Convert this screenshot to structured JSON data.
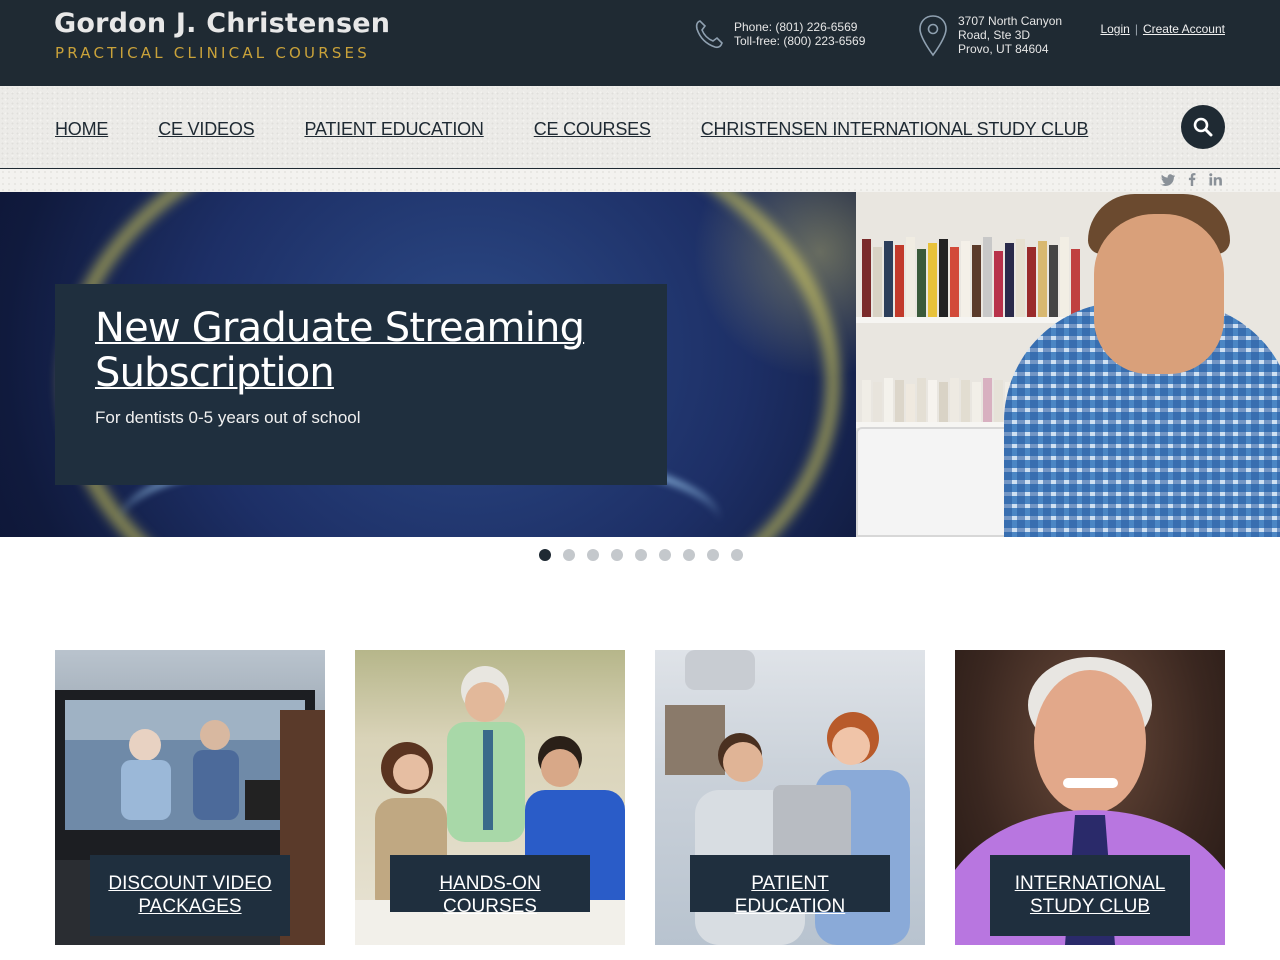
{
  "header": {
    "logo_title": "Gordon J. Christensen",
    "logo_subtitle": "PRACTICAL CLINICAL COURSES",
    "phone_line": "Phone: (801) 226-6569",
    "tollfree_line": "Toll-free: (800) 223-6569",
    "address_line1": "3707 North Canyon",
    "address_line2": "Road, Ste 3D",
    "address_line3": "Provo, UT 84604",
    "login_label": "Login",
    "separator": "|",
    "create_account_label": "Create Account"
  },
  "nav": {
    "items": [
      {
        "label": "HOME"
      },
      {
        "label": "CE VIDEOS"
      },
      {
        "label": "PATIENT EDUCATION"
      },
      {
        "label": "CE COURSES"
      },
      {
        "label": "CHRISTENSEN INTERNATIONAL STUDY CLUB"
      }
    ],
    "search_icon": "search-icon"
  },
  "social": {
    "icons": [
      "twitter-icon",
      "facebook-icon",
      "linkedin-icon"
    ]
  },
  "hero": {
    "title": "New Graduate Streaming Subscription",
    "subtitle": "For dentists 0-5 years out of school",
    "slide_count": 9,
    "active_slide": 1
  },
  "tiles": [
    {
      "label": "DISCOUNT VIDEO PACKAGES"
    },
    {
      "label": "HANDS-ON COURSES"
    },
    {
      "label": "PATIENT EDUCATION"
    },
    {
      "label": "INTERNATIONAL STUDY CLUB"
    }
  ],
  "colors": {
    "header_bg": "#1f2a33",
    "accent_gold": "#c9a23a",
    "caption_bg": "#1f2f3e"
  }
}
